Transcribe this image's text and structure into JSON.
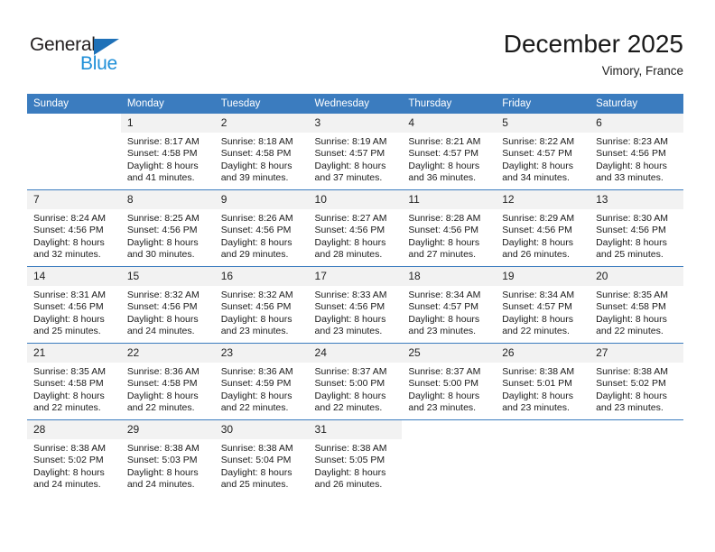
{
  "brand": {
    "name_part1": "General",
    "name_part2": "Blue",
    "triangle_icon": "triangle-icon",
    "color_dark": "#231f20",
    "color_blue": "#1f8fd8",
    "color_triangle": "#1f71b8"
  },
  "header": {
    "title": "December 2025",
    "location": "Vimory, France"
  },
  "theme": {
    "header_bg": "#3b7cbf",
    "daynum_bg": "#f2f2f2",
    "grid_line": "#3b7cbf"
  },
  "weekdays": [
    "Sunday",
    "Monday",
    "Tuesday",
    "Wednesday",
    "Thursday",
    "Friday",
    "Saturday"
  ],
  "weeks": [
    [
      {
        "day": "",
        "blank": true,
        "sunrise": "",
        "sunset": "",
        "daylight1": "",
        "daylight2": ""
      },
      {
        "day": "1",
        "sunrise": "Sunrise: 8:17 AM",
        "sunset": "Sunset: 4:58 PM",
        "daylight1": "Daylight: 8 hours",
        "daylight2": "and 41 minutes."
      },
      {
        "day": "2",
        "sunrise": "Sunrise: 8:18 AM",
        "sunset": "Sunset: 4:58 PM",
        "daylight1": "Daylight: 8 hours",
        "daylight2": "and 39 minutes."
      },
      {
        "day": "3",
        "sunrise": "Sunrise: 8:19 AM",
        "sunset": "Sunset: 4:57 PM",
        "daylight1": "Daylight: 8 hours",
        "daylight2": "and 37 minutes."
      },
      {
        "day": "4",
        "sunrise": "Sunrise: 8:21 AM",
        "sunset": "Sunset: 4:57 PM",
        "daylight1": "Daylight: 8 hours",
        "daylight2": "and 36 minutes."
      },
      {
        "day": "5",
        "sunrise": "Sunrise: 8:22 AM",
        "sunset": "Sunset: 4:57 PM",
        "daylight1": "Daylight: 8 hours",
        "daylight2": "and 34 minutes."
      },
      {
        "day": "6",
        "sunrise": "Sunrise: 8:23 AM",
        "sunset": "Sunset: 4:56 PM",
        "daylight1": "Daylight: 8 hours",
        "daylight2": "and 33 minutes."
      }
    ],
    [
      {
        "day": "7",
        "sunrise": "Sunrise: 8:24 AM",
        "sunset": "Sunset: 4:56 PM",
        "daylight1": "Daylight: 8 hours",
        "daylight2": "and 32 minutes."
      },
      {
        "day": "8",
        "sunrise": "Sunrise: 8:25 AM",
        "sunset": "Sunset: 4:56 PM",
        "daylight1": "Daylight: 8 hours",
        "daylight2": "and 30 minutes."
      },
      {
        "day": "9",
        "sunrise": "Sunrise: 8:26 AM",
        "sunset": "Sunset: 4:56 PM",
        "daylight1": "Daylight: 8 hours",
        "daylight2": "and 29 minutes."
      },
      {
        "day": "10",
        "sunrise": "Sunrise: 8:27 AM",
        "sunset": "Sunset: 4:56 PM",
        "daylight1": "Daylight: 8 hours",
        "daylight2": "and 28 minutes."
      },
      {
        "day": "11",
        "sunrise": "Sunrise: 8:28 AM",
        "sunset": "Sunset: 4:56 PM",
        "daylight1": "Daylight: 8 hours",
        "daylight2": "and 27 minutes."
      },
      {
        "day": "12",
        "sunrise": "Sunrise: 8:29 AM",
        "sunset": "Sunset: 4:56 PM",
        "daylight1": "Daylight: 8 hours",
        "daylight2": "and 26 minutes."
      },
      {
        "day": "13",
        "sunrise": "Sunrise: 8:30 AM",
        "sunset": "Sunset: 4:56 PM",
        "daylight1": "Daylight: 8 hours",
        "daylight2": "and 25 minutes."
      }
    ],
    [
      {
        "day": "14",
        "sunrise": "Sunrise: 8:31 AM",
        "sunset": "Sunset: 4:56 PM",
        "daylight1": "Daylight: 8 hours",
        "daylight2": "and 25 minutes."
      },
      {
        "day": "15",
        "sunrise": "Sunrise: 8:32 AM",
        "sunset": "Sunset: 4:56 PM",
        "daylight1": "Daylight: 8 hours",
        "daylight2": "and 24 minutes."
      },
      {
        "day": "16",
        "sunrise": "Sunrise: 8:32 AM",
        "sunset": "Sunset: 4:56 PM",
        "daylight1": "Daylight: 8 hours",
        "daylight2": "and 23 minutes."
      },
      {
        "day": "17",
        "sunrise": "Sunrise: 8:33 AM",
        "sunset": "Sunset: 4:56 PM",
        "daylight1": "Daylight: 8 hours",
        "daylight2": "and 23 minutes."
      },
      {
        "day": "18",
        "sunrise": "Sunrise: 8:34 AM",
        "sunset": "Sunset: 4:57 PM",
        "daylight1": "Daylight: 8 hours",
        "daylight2": "and 23 minutes."
      },
      {
        "day": "19",
        "sunrise": "Sunrise: 8:34 AM",
        "sunset": "Sunset: 4:57 PM",
        "daylight1": "Daylight: 8 hours",
        "daylight2": "and 22 minutes."
      },
      {
        "day": "20",
        "sunrise": "Sunrise: 8:35 AM",
        "sunset": "Sunset: 4:58 PM",
        "daylight1": "Daylight: 8 hours",
        "daylight2": "and 22 minutes."
      }
    ],
    [
      {
        "day": "21",
        "sunrise": "Sunrise: 8:35 AM",
        "sunset": "Sunset: 4:58 PM",
        "daylight1": "Daylight: 8 hours",
        "daylight2": "and 22 minutes."
      },
      {
        "day": "22",
        "sunrise": "Sunrise: 8:36 AM",
        "sunset": "Sunset: 4:58 PM",
        "daylight1": "Daylight: 8 hours",
        "daylight2": "and 22 minutes."
      },
      {
        "day": "23",
        "sunrise": "Sunrise: 8:36 AM",
        "sunset": "Sunset: 4:59 PM",
        "daylight1": "Daylight: 8 hours",
        "daylight2": "and 22 minutes."
      },
      {
        "day": "24",
        "sunrise": "Sunrise: 8:37 AM",
        "sunset": "Sunset: 5:00 PM",
        "daylight1": "Daylight: 8 hours",
        "daylight2": "and 22 minutes."
      },
      {
        "day": "25",
        "sunrise": "Sunrise: 8:37 AM",
        "sunset": "Sunset: 5:00 PM",
        "daylight1": "Daylight: 8 hours",
        "daylight2": "and 23 minutes."
      },
      {
        "day": "26",
        "sunrise": "Sunrise: 8:38 AM",
        "sunset": "Sunset: 5:01 PM",
        "daylight1": "Daylight: 8 hours",
        "daylight2": "and 23 minutes."
      },
      {
        "day": "27",
        "sunrise": "Sunrise: 8:38 AM",
        "sunset": "Sunset: 5:02 PM",
        "daylight1": "Daylight: 8 hours",
        "daylight2": "and 23 minutes."
      }
    ],
    [
      {
        "day": "28",
        "sunrise": "Sunrise: 8:38 AM",
        "sunset": "Sunset: 5:02 PM",
        "daylight1": "Daylight: 8 hours",
        "daylight2": "and 24 minutes."
      },
      {
        "day": "29",
        "sunrise": "Sunrise: 8:38 AM",
        "sunset": "Sunset: 5:03 PM",
        "daylight1": "Daylight: 8 hours",
        "daylight2": "and 24 minutes."
      },
      {
        "day": "30",
        "sunrise": "Sunrise: 8:38 AM",
        "sunset": "Sunset: 5:04 PM",
        "daylight1": "Daylight: 8 hours",
        "daylight2": "and 25 minutes."
      },
      {
        "day": "31",
        "sunrise": "Sunrise: 8:38 AM",
        "sunset": "Sunset: 5:05 PM",
        "daylight1": "Daylight: 8 hours",
        "daylight2": "and 26 minutes."
      },
      {
        "day": "",
        "blank": true,
        "sunrise": "",
        "sunset": "",
        "daylight1": "",
        "daylight2": ""
      },
      {
        "day": "",
        "blank": true,
        "sunrise": "",
        "sunset": "",
        "daylight1": "",
        "daylight2": ""
      },
      {
        "day": "",
        "blank": true,
        "sunrise": "",
        "sunset": "",
        "daylight1": "",
        "daylight2": ""
      }
    ]
  ]
}
